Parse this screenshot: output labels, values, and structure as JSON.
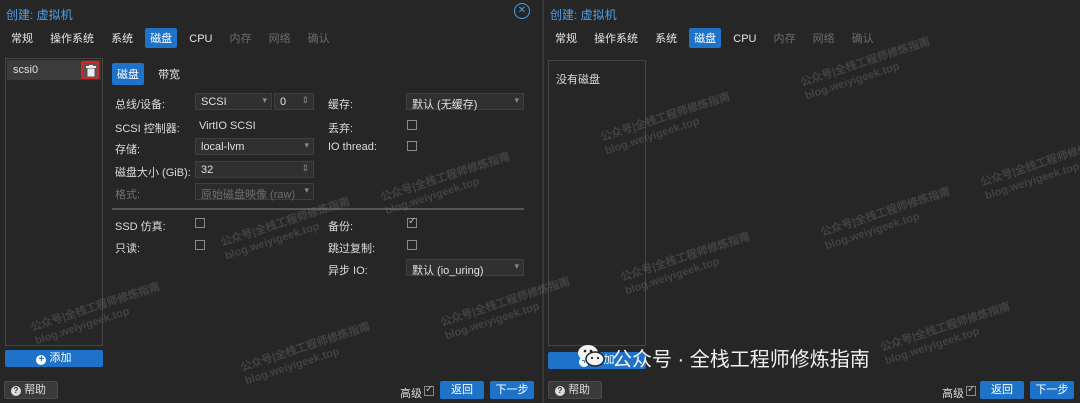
{
  "left": {
    "title": "创建: 虚拟机",
    "tabs": [
      {
        "label": "常规"
      },
      {
        "label": "操作系统"
      },
      {
        "label": "系统"
      },
      {
        "label": "磁盘"
      },
      {
        "label": "CPU"
      },
      {
        "label": "内存"
      },
      {
        "label": "网络"
      },
      {
        "label": "确认"
      }
    ],
    "disk_list": {
      "item": "scsi0"
    },
    "add_label": "添加",
    "subtabs": [
      {
        "label": "磁盘"
      },
      {
        "label": "带宽"
      }
    ],
    "form": {
      "bus_label": "总线/设备:",
      "bus_value": "SCSI",
      "bus_index": "0",
      "controller_label": "SCSI 控制器:",
      "controller_value": "VirtIO SCSI",
      "storage_label": "存储:",
      "storage_value": "local-lvm",
      "size_label": "磁盘大小 (GiB):",
      "size_value": "32",
      "format_label": "格式:",
      "format_value": "原始磁盘映像 (raw)",
      "cache_label": "缓存:",
      "cache_value": "默认 (无缓存)",
      "discard_label": "丢弃:",
      "iothread_label": "IO thread:",
      "ssd_label": "SSD 仿真:",
      "readonly_label": "只读:",
      "backup_label": "备份:",
      "skip_label": "跳过复制:",
      "async_label": "异步 IO:",
      "async_value": "默认 (io_uring)"
    },
    "footer": {
      "help": "帮助",
      "advanced": "高级",
      "back": "返回",
      "next": "下一步"
    }
  },
  "right": {
    "title": "创建: 虚拟机",
    "tabs": [
      {
        "label": "常规"
      },
      {
        "label": "操作系统"
      },
      {
        "label": "系统"
      },
      {
        "label": "磁盘"
      },
      {
        "label": "CPU"
      },
      {
        "label": "内存"
      },
      {
        "label": "网络"
      },
      {
        "label": "确认"
      }
    ],
    "empty_text": "没有磁盘",
    "add_label": "添加",
    "footer": {
      "help": "帮助",
      "advanced": "高级",
      "back": "返回",
      "next": "下一步"
    }
  },
  "watermark": {
    "line1": "公众号|全栈工程师修炼指南",
    "line2": "blog.weiyigeek.top"
  },
  "bottom_watermark": "公众号 · 全栈工程师修炼指南",
  "colors": {
    "accent": "#1e73c8",
    "title": "#4c9fe8",
    "highlight": "#d22222"
  }
}
